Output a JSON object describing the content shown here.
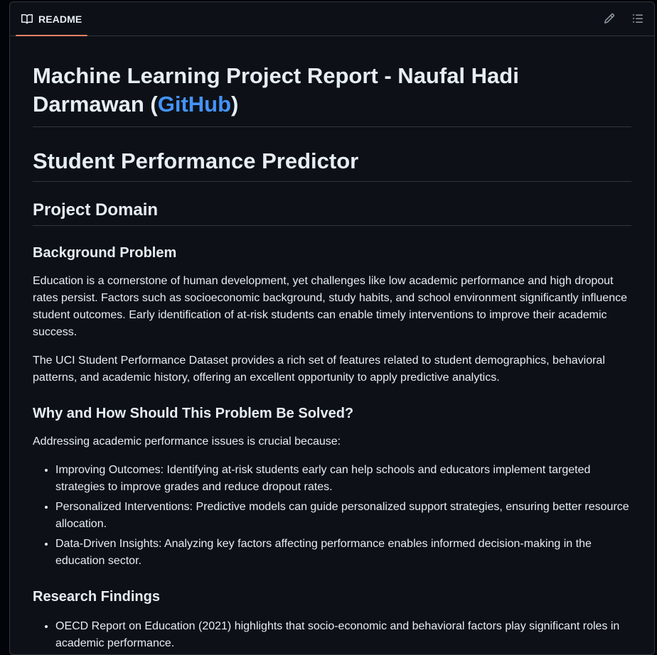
{
  "tab": {
    "label": "README",
    "icon": "book-icon"
  },
  "actions": {
    "edit_icon": "pencil-icon",
    "toc_icon": "list-unordered-icon"
  },
  "colors": {
    "accent_tab_underline": "#f78166",
    "link": "#4493f8",
    "background": "#0d1117",
    "border": "#30363d",
    "text": "#e6edf3"
  },
  "doc": {
    "title_prefix": "Machine Learning Project Report - Naufal Hadi Darmawan (",
    "title_link": "GitHub",
    "title_suffix": ")",
    "subtitle": "Student Performance Predictor",
    "section_project_domain": "Project Domain",
    "background_heading": "Background Problem",
    "background_p1": "Education is a cornerstone of human development, yet challenges like low academic performance and high dropout rates persist. Factors such as socioeconomic background, study habits, and school environment significantly influence student outcomes. Early identification of at-risk students can enable timely interventions to improve their academic success.",
    "background_p2": "The UCI Student Performance Dataset provides a rich set of features related to student demographics, behavioral patterns, and academic history, offering an excellent opportunity to apply predictive analytics.",
    "why_heading": "Why and How Should This Problem Be Solved?",
    "why_intro": "Addressing academic performance issues is crucial because:",
    "why_items": [
      "Improving Outcomes: Identifying at-risk students early can help schools and educators implement targeted strategies to improve grades and reduce dropout rates.",
      "Personalized Interventions: Predictive models can guide personalized support strategies, ensuring better resource allocation.",
      "Data-Driven Insights: Analyzing key factors affecting performance enables informed decision-making in the education sector."
    ],
    "research_heading": "Research Findings",
    "research_items": [
      "OECD Report on Education (2021) highlights that socio-economic and behavioral factors play significant roles in academic performance."
    ]
  }
}
